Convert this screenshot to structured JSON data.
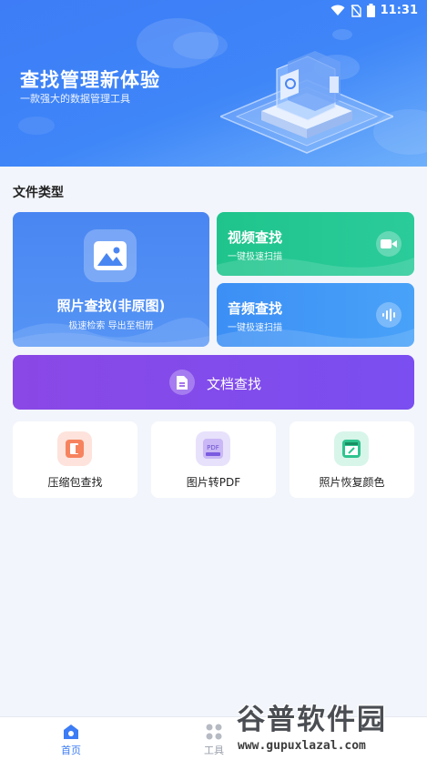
{
  "status_bar": {
    "time": "11:31"
  },
  "header": {
    "title": "查找管理新体验",
    "subtitle": "一款强大的数据管理工具"
  },
  "section": {
    "title": "文件类型"
  },
  "cards": {
    "photo": {
      "title": "照片查找(非原图)",
      "subtitle": "极速检索 导出至相册"
    },
    "video": {
      "title": "视频查找",
      "subtitle": "一键极速扫描"
    },
    "audio": {
      "title": "音频查找",
      "subtitle": "一键极速扫描"
    },
    "document": {
      "title": "文档查找"
    }
  },
  "tools": [
    {
      "label": "压缩包查找",
      "icon": "archive-icon"
    },
    {
      "label": "图片转PDF",
      "icon": "pdf-icon",
      "badge": "PDF"
    },
    {
      "label": "照片恢复颜色",
      "icon": "color-restore-icon"
    }
  ],
  "bottom_nav": [
    {
      "label": "首页",
      "active": true
    },
    {
      "label": "工具",
      "active": false
    }
  ],
  "watermark": {
    "brand": "谷普软件园",
    "url": "www.gupuxlazal.com"
  },
  "colors": {
    "header_blue": "#3d7cf6",
    "photo_card": "#4a86f2",
    "video_card": "#1fc48c",
    "audio_card": "#3c8ff5",
    "doc_card": "#8a48e6",
    "active_nav": "#3c7cf5"
  }
}
